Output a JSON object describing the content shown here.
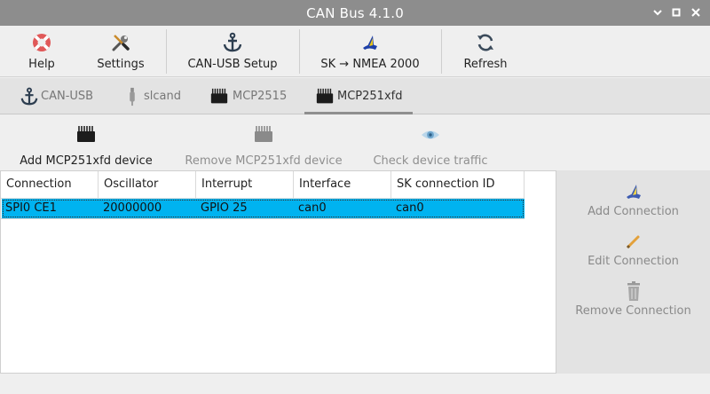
{
  "window": {
    "title": "CAN Bus 4.1.0",
    "controls": {
      "minimize": "⌄",
      "maximize": "□",
      "close": "✕"
    }
  },
  "toolbar": {
    "help_label": "Help",
    "settings_label": "Settings",
    "can_usb_setup_label": "CAN-USB Setup",
    "sk_nmea_label": "SK → NMEA 2000",
    "refresh_label": "Refresh"
  },
  "tabs": [
    {
      "label": "CAN-USB",
      "icon": "anchor-icon",
      "active": false
    },
    {
      "label": "slcand",
      "icon": "usb-stick-icon",
      "active": false
    },
    {
      "label": "MCP2515",
      "icon": "chip-icon",
      "active": false
    },
    {
      "label": "MCP251xfd",
      "icon": "chip-icon",
      "active": true
    }
  ],
  "actions": {
    "add_device_label": "Add MCP251xfd device",
    "remove_device_label": "Remove MCP251xfd device",
    "check_traffic_label": "Check device traffic"
  },
  "table": {
    "columns": [
      "Connection",
      "Oscillator",
      "Interrupt",
      "Interface",
      "SK connection ID"
    ],
    "rows": [
      [
        "SPI0 CE1",
        "20000000",
        "GPIO 25",
        "can0",
        "can0"
      ]
    ]
  },
  "side_actions": {
    "add_connection_label": "Add Connection",
    "edit_connection_label": "Edit Connection",
    "remove_connection_label": "Remove Connection"
  },
  "colors": {
    "titlebar": "#8d8d8d",
    "selection": "#00b3f0",
    "help_icon_red": "#e05858",
    "sk_blue": "#1d3fa8",
    "sk_yellow": "#e8c51a"
  }
}
